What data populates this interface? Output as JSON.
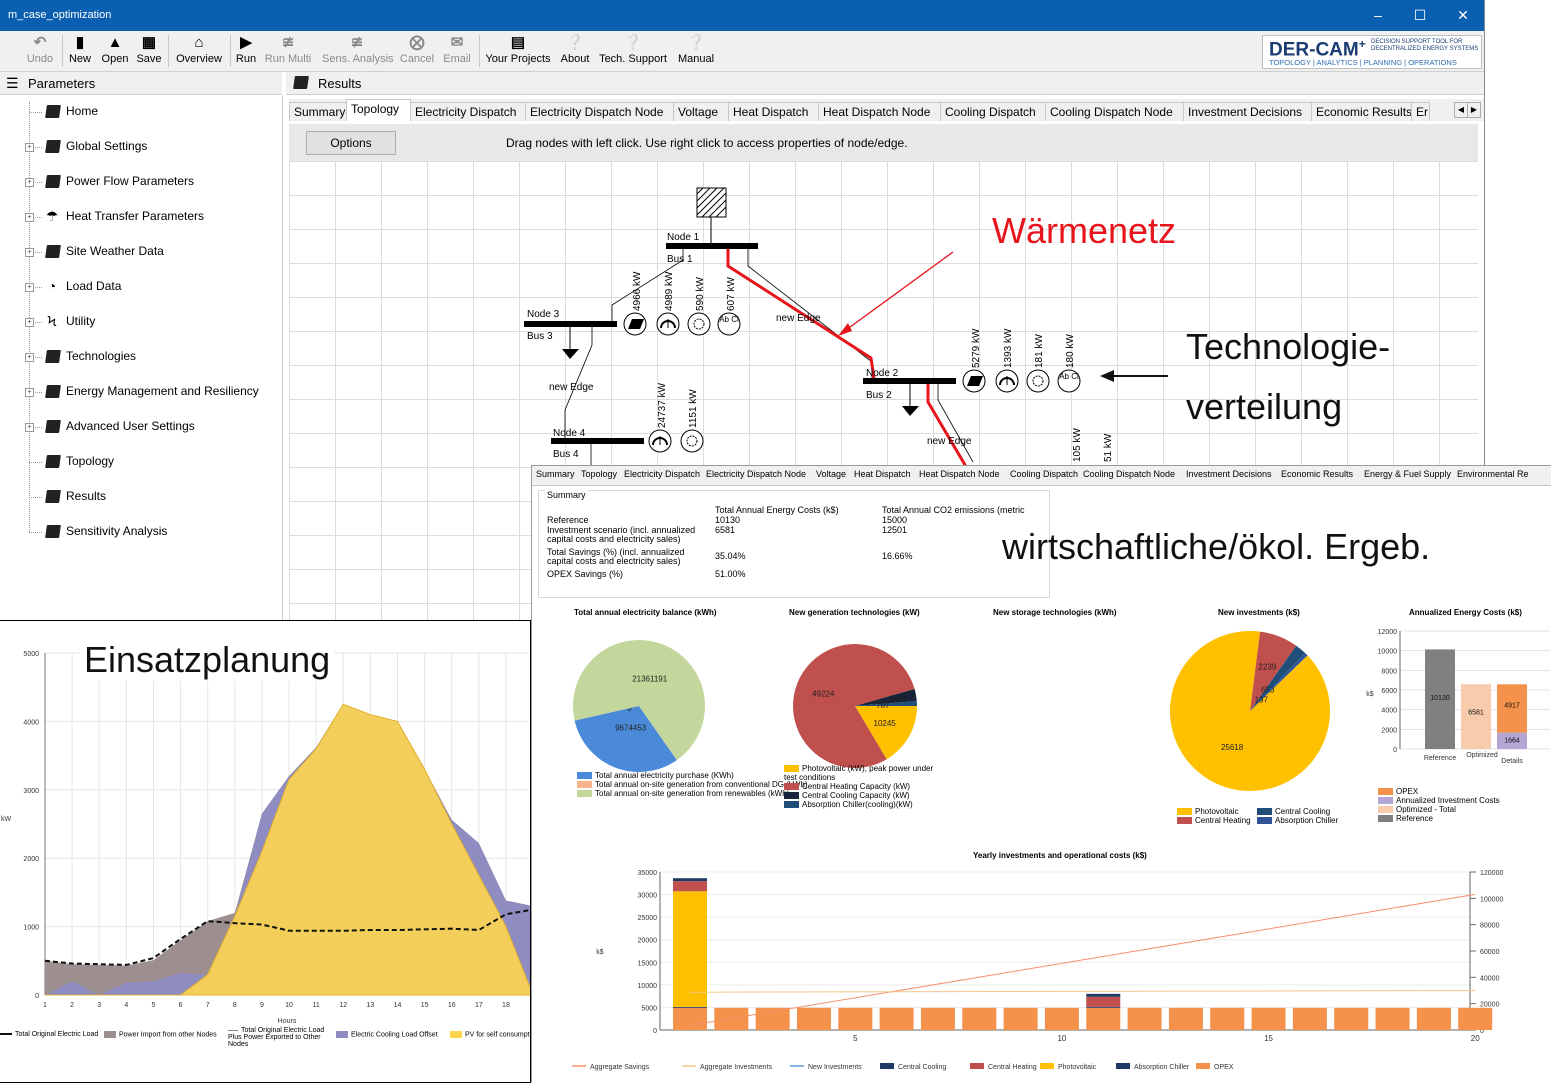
{
  "window": {
    "title": "m_case_optimization"
  },
  "toolbar": {
    "undo": "Undo",
    "new": "New",
    "open": "Open",
    "save": "Save",
    "overview": "Overview",
    "run": "Run",
    "run_multi": "Run Multi",
    "sens_analysis": "Sens. Analysis",
    "cancel": "Cancel",
    "email": "Email",
    "your_projects": "Your Projects",
    "about": "About",
    "tech_support": "Tech. Support",
    "manual": "Manual"
  },
  "logo": {
    "name": "DER-CAM",
    "sup": "+",
    "tagline": "DECISION SUPPORT TOOL FOR DECENTRALIZED ENERGY SYSTEMS",
    "subtitle": "TOPOLOGY | ANALYTICS | PLANNING | OPERATIONS"
  },
  "panes": {
    "parameters": "Parameters",
    "results": "Results"
  },
  "tree": [
    {
      "label": "Home",
      "expandable": false,
      "icon": "book-icon"
    },
    {
      "label": "Global Settings",
      "expandable": true,
      "icon": "book-icon"
    },
    {
      "label": "Power Flow Parameters",
      "expandable": true,
      "icon": "book-icon"
    },
    {
      "label": "Heat Transfer Parameters",
      "expandable": true,
      "icon": "umbrella-icon"
    },
    {
      "label": "Site Weather Data",
      "expandable": true,
      "icon": "book-icon"
    },
    {
      "label": "Load Data",
      "expandable": true,
      "icon": "gauge-icon"
    },
    {
      "label": "Utility",
      "expandable": true,
      "icon": "lightning-icon"
    },
    {
      "label": "Technologies",
      "expandable": true,
      "icon": "book-icon"
    },
    {
      "label": "Energy Management and Resiliency",
      "expandable": true,
      "icon": "book-icon"
    },
    {
      "label": "Advanced User Settings",
      "expandable": true,
      "icon": "book-icon"
    },
    {
      "label": "Topology",
      "expandable": false,
      "icon": "book-icon"
    },
    {
      "label": "Results",
      "expandable": false,
      "icon": "book-icon"
    },
    {
      "label": "Sensitivity Analysis",
      "expandable": false,
      "icon": "book-icon"
    }
  ],
  "tabs": [
    "Summary",
    "Topology",
    "Electricity Dispatch",
    "Electricity Dispatch Node",
    "Voltage",
    "Heat Dispatch",
    "Heat Dispatch Node",
    "Cooling Dispatch",
    "Cooling Dispatch Node",
    "Investment Decisions",
    "Economic Results",
    "Er"
  ],
  "active_tab": "Topology",
  "topology": {
    "options_label": "Options",
    "hint": "Drag nodes with left click. Use right click to access properties of node/edge.",
    "node1": "Node 1",
    "bus1": "Bus 1",
    "node2": "Node 2",
    "bus2": "Bus 2",
    "node3": "Node 3",
    "bus3": "Bus 3",
    "node4": "Node 4",
    "bus4": "Bus 4",
    "edge_label": "new Edge",
    "node3_kw": [
      "4966 kW",
      "4989 kW",
      "590 kW",
      "607 kW"
    ],
    "node2_kw": [
      "5279 kW",
      "1393 kW",
      "181 kW",
      "180 kW"
    ],
    "node4_kw": [
      "24737 kW",
      "1151 kW"
    ],
    "partial_kw": [
      "105 kW",
      "51 kW"
    ],
    "abcl": "Ab Cl"
  },
  "annotations": {
    "waermenetz": "Wärmenetz",
    "tech_line1": "Technologie-",
    "tech_line2": "verteilung",
    "eco": "wirtschaftliche/ökol. Ergeb.",
    "einsatz": "Einsatzplanung",
    "colors": {
      "red": "#e8141b",
      "black": "#111111"
    }
  },
  "summary_tabs": [
    "Summary",
    "Topology",
    "Electricity Dispatch",
    "Electricity Dispatch Node",
    "Voltage",
    "Heat Dispatch",
    "Heat Dispatch Node",
    "Cooling Dispatch",
    "Cooling Dispatch Node",
    "Investment Decisions",
    "Economic Results",
    "Energy & Fuel Supply",
    "Environmental Re"
  ],
  "summary": {
    "group": "Summary",
    "col1": "Total Annual Energy Costs (k$)",
    "col2": "Total Annual CO2 emissions (metric",
    "rows": [
      {
        "l1": "Reference",
        "l2": "",
        "v1": "10130",
        "v2": "15000"
      },
      {
        "l1": "Investment scenario (incl. annualized",
        "l2": "capital costs and electricity sales)",
        "v1": "6581",
        "v2": "12501"
      },
      {
        "l1": "Total Savings (%) (incl. annualized",
        "l2": "capital costs and electricity sales)",
        "v1": "35.04%",
        "v2": "16.66%"
      },
      {
        "l1": "OPEX Savings (%)",
        "l2": "",
        "v1": "51.00%",
        "v2": ""
      }
    ]
  },
  "chart_data": [
    {
      "type": "pie",
      "title": "Total annual electricity balance (kWh)",
      "slices": [
        {
          "label": "Total annual electricity purchase (KWh)",
          "value": 9674453,
          "color": "#4a8ad8"
        },
        {
          "label": "Total annual on-site generation from conventional DG (kWh)",
          "value": 0,
          "color": "#f7b38c"
        },
        {
          "label": "Total annual on-site generation from renewables (kWh)",
          "value": 21361191,
          "color": "#c3d69b"
        }
      ],
      "data_labels": [
        "9674453",
        "0",
        "21361191"
      ]
    },
    {
      "type": "pie",
      "title": "New generation technologies (kW)",
      "slices": [
        {
          "label": "Photovoltaic (kW), peak power under test conditions",
          "value": 10245,
          "color": "#ffc000"
        },
        {
          "label": "Central Heating Capacity (kW)",
          "value": 49224,
          "color": "#c0504d"
        },
        {
          "label": "Central Cooling Capacity (kW)",
          "value": 1968,
          "color": "#17243a"
        },
        {
          "label": "Absorption Chiller(cooling)(kW)",
          "value": 787,
          "color": "#1f4e79"
        }
      ],
      "data_labels": [
        "10245",
        "49224",
        "1968",
        "787"
      ]
    },
    {
      "type": "pie",
      "title": "New storage technologies (kWh)",
      "slices": []
    },
    {
      "type": "pie",
      "title": "New investments (k$)",
      "slices": [
        {
          "label": "Photovoltaic",
          "value": 25618,
          "color": "#ffc000"
        },
        {
          "label": "Central Heating",
          "value": 2239,
          "color": "#c0504d"
        },
        {
          "label": "Central Cooling",
          "value": 653,
          "color": "#1f4e79"
        },
        {
          "label": "Absorption Chiller",
          "value": 197,
          "color": "#2f5597"
        }
      ],
      "data_labels": [
        "25618",
        "2239",
        "653",
        "197"
      ]
    },
    {
      "type": "bar",
      "title": "Annualized Energy Costs (k$)",
      "categories": [
        "Reference",
        "Optimized",
        "Details"
      ],
      "ylabel": "k$",
      "ylim": [
        0,
        12000
      ],
      "yticks": [
        0,
        2000,
        4000,
        6000,
        8000,
        10000,
        12000
      ],
      "series": [
        {
          "name": "Reference",
          "values": [
            10130,
            0,
            0
          ],
          "color": "#808080"
        },
        {
          "name": "Optimized - Total",
          "values": [
            0,
            6581,
            0
          ],
          "color": "#f8cbad"
        },
        {
          "name": "Annualized Investment Costs",
          "values": [
            0,
            0,
            1664
          ],
          "color": "#b4a7d6"
        },
        {
          "name": "OPEX",
          "values": [
            0,
            0,
            4917
          ],
          "color": "#f4914b"
        }
      ],
      "data_labels": [
        "10130",
        "6581",
        "4917",
        "1664"
      ],
      "legend": [
        "OPEX",
        "Annualized Investment Costs",
        "Optimized - Total",
        "Reference"
      ]
    },
    {
      "type": "bar",
      "title": "Yearly investments and operational costs (k$)",
      "x": [
        1,
        2,
        3,
        4,
        5,
        6,
        7,
        8,
        9,
        10,
        11,
        12,
        13,
        14,
        15,
        16,
        17,
        18,
        19,
        20
      ],
      "xticks": [
        5,
        10,
        15,
        20
      ],
      "ylabel": "k$",
      "ylim": [
        0,
        35000
      ],
      "yticks": [
        0,
        5000,
        10000,
        15000,
        20000,
        25000,
        30000,
        35000
      ],
      "y2lim": [
        0,
        120000
      ],
      "y2ticks": [
        0,
        20000,
        40000,
        60000,
        80000,
        100000,
        120000
      ],
      "series": [
        {
          "name": "OPEX",
          "values": [
            4917,
            4917,
            4917,
            4917,
            4917,
            4917,
            4917,
            4917,
            4917,
            4917,
            4917,
            4917,
            4917,
            4917,
            4917,
            4917,
            4917,
            4917,
            4917,
            4917
          ],
          "color": "#f4914b"
        },
        {
          "name": "Absorption Chiller",
          "values": [
            197,
            0,
            0,
            0,
            0,
            0,
            0,
            0,
            0,
            0,
            197,
            0,
            0,
            0,
            0,
            0,
            0,
            0,
            0,
            0
          ],
          "color": "#1f3864"
        },
        {
          "name": "Photovoltaic",
          "values": [
            25618,
            0,
            0,
            0,
            0,
            0,
            0,
            0,
            0,
            0,
            0,
            0,
            0,
            0,
            0,
            0,
            0,
            0,
            0,
            0
          ],
          "color": "#ffc000"
        },
        {
          "name": "Central Heating",
          "values": [
            2239,
            0,
            0,
            0,
            0,
            0,
            0,
            0,
            0,
            0,
            2239,
            0,
            0,
            0,
            0,
            0,
            0,
            0,
            0,
            0
          ],
          "color": "#c0504d"
        },
        {
          "name": "Central Cooling",
          "values": [
            653,
            0,
            0,
            0,
            0,
            0,
            0,
            0,
            0,
            0,
            653,
            0,
            0,
            0,
            0,
            0,
            0,
            0,
            0,
            0
          ],
          "color": "#203864"
        },
        {
          "name": "New Investments",
          "values": [],
          "color": "#5b9bd5"
        }
      ],
      "lines": [
        {
          "name": "Aggregate Savings",
          "x": [
            1,
            20
          ],
          "y2": [
            3500,
            103000
          ],
          "color": "#f4916b"
        },
        {
          "name": "Aggregate Investments",
          "x": [
            1,
            20
          ],
          "y2": [
            28700,
            30000
          ],
          "color": "#f4c58b"
        }
      ],
      "legend": [
        "Aggregate Savings",
        "Aggregate Investments",
        "New Investments",
        "Central Cooling",
        "Central Heating",
        "Photovoltaic",
        "Absorption Chiller",
        "OPEX"
      ]
    },
    {
      "type": "area",
      "x": [
        1,
        2,
        3,
        4,
        5,
        6,
        7,
        8,
        9,
        10,
        11,
        12,
        13,
        14,
        15,
        16,
        17,
        18,
        19
      ],
      "xticks": [
        1,
        2,
        3,
        4,
        5,
        6,
        7,
        8,
        9,
        10,
        11,
        12,
        13,
        14,
        15,
        16,
        17,
        18
      ],
      "xlabel": "Hours",
      "ylabel": "kW",
      "ylim": [
        0,
        5000
      ],
      "yticks": [
        0,
        1000,
        2000,
        3000,
        4000,
        5000
      ],
      "series": [
        {
          "name": "Power Import from other Nodes",
          "values": [
            500,
            450,
            440,
            430,
            510,
            800,
            1080,
            1200,
            2650,
            3200,
            3620,
            4250,
            4100,
            4000,
            3300,
            2560,
            2220,
            1380,
            1300
          ],
          "color": "#9d8f8f"
        },
        {
          "name": "Electric Cooling Load Offset",
          "values": [
            0,
            200,
            0,
            180,
            200,
            320,
            300,
            1150,
            2650,
            3200,
            3620,
            4250,
            4100,
            4000,
            3300,
            2560,
            2220,
            1380,
            1300
          ],
          "color": "#8e8cc1"
        },
        {
          "name": "PV for self consumpt",
          "values": [
            0,
            0,
            0,
            0,
            0,
            0,
            300,
            1150,
            2100,
            3150,
            3600,
            4250,
            4100,
            4000,
            3300,
            2500,
            1750,
            1000,
            0
          ],
          "color": "#ffd54f"
        },
        {
          "name": "Total Original Electric Load",
          "values": [
            500,
            460,
            450,
            440,
            540,
            820,
            1080,
            1050,
            1030,
            940,
            940,
            940,
            950,
            950,
            960,
            970,
            950,
            1180,
            1250
          ],
          "color": "#111111"
        },
        {
          "name": "Total Original Electric Load Plus Power Exported to Other Nodes",
          "values": [],
          "color": "#888888"
        }
      ],
      "legend": [
        "Total Original Electric Load",
        "Power Import from other Nodes",
        "Total Original Electric Load Plus Power Exported to Other Nodes",
        "Electric Cooling Load Offset",
        "PV for self consumpt"
      ]
    }
  ]
}
